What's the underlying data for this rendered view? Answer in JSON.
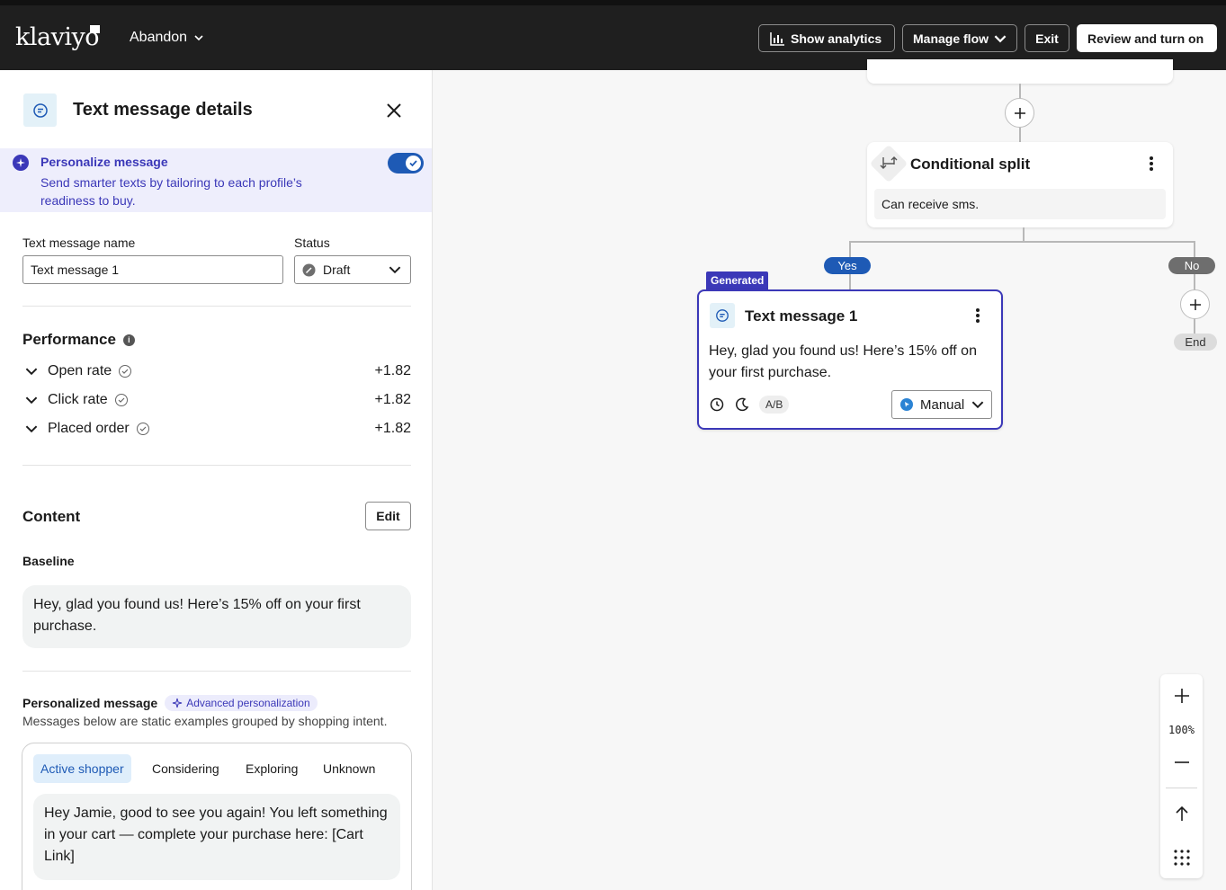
{
  "header": {
    "logo": "klaviyo",
    "flow_name": "Abandon",
    "show_analytics": "Show analytics",
    "manage_flow": "Manage flow",
    "exit": "Exit",
    "review": "Review and turn on"
  },
  "panel": {
    "title": "Text message details",
    "personalize": {
      "title": "Personalize message",
      "desc": "Send smarter texts by tailoring to each profile’s readiness to buy.",
      "enabled": true
    },
    "name_label": "Text message name",
    "name_value": "Text message 1",
    "status_label": "Status",
    "status_value": "Draft",
    "performance": {
      "title": "Performance",
      "metrics": [
        {
          "label": "Open rate",
          "value": "+1.82"
        },
        {
          "label": "Click rate",
          "value": "+1.82"
        },
        {
          "label": "Placed order",
          "value": "+1.82"
        }
      ]
    },
    "content": {
      "title": "Content",
      "edit": "Edit",
      "baseline_label": "Baseline",
      "baseline_text": "Hey, glad you found us! Here’s 15% off on your first purchase."
    },
    "personalized": {
      "title": "Personalized message",
      "badge": "Advanced personalization",
      "desc": "Messages below are static examples grouped by shopping intent.",
      "tabs": [
        "Active shopper",
        "Considering",
        "Exploring",
        "Unknown"
      ],
      "active_tab": "Active shopper",
      "message": "Hey Jamie, good to see you again! You left something in your cart — complete your purchase here: [Cart Link]"
    }
  },
  "canvas": {
    "split": {
      "title": "Conditional split",
      "condition": "Can receive sms."
    },
    "yes_label": "Yes",
    "no_label": "No",
    "end_label": "End",
    "sms_node": {
      "badge": "Generated",
      "title": "Text message 1",
      "body": "Hey, glad you found us! Here’s 15% off on your first purchase.",
      "ab_label": "A/B",
      "mode": "Manual"
    },
    "zoom_level": "100%"
  },
  "colors": {
    "accent_purple": "#3b38b8",
    "accent_blue": "#1e5ab5",
    "topbar": "#1f1f1f"
  }
}
